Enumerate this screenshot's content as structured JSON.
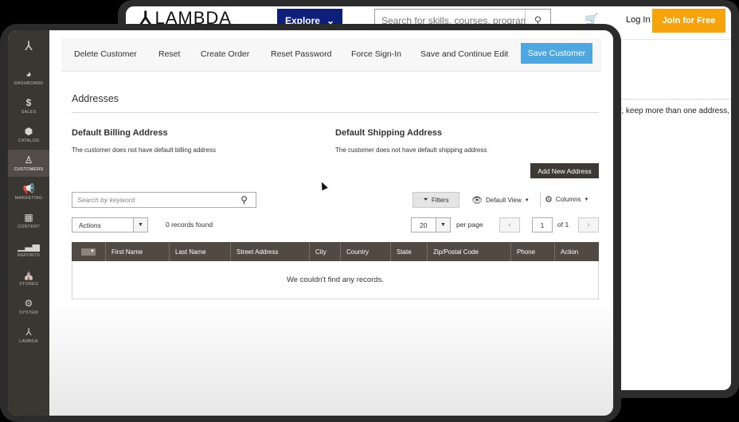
{
  "website": {
    "logo_text": "LAMBDA",
    "explore_label": "Explore",
    "search_placeholder": "Search for skills, courses, programmes",
    "login_label": "Log In",
    "join_label": "Join for Free",
    "side_text": "er, keep more than one address,"
  },
  "sidebar": {
    "items": [
      {
        "label": "DASHBOARD",
        "icon": "dashboard-icon"
      },
      {
        "label": "SALES",
        "icon": "dollar-icon"
      },
      {
        "label": "CATALOG",
        "icon": "cube-icon"
      },
      {
        "label": "CUSTOMERS",
        "icon": "person-icon",
        "active": true
      },
      {
        "label": "MARKETING",
        "icon": "megaphone-icon"
      },
      {
        "label": "CONTENT",
        "icon": "content-icon"
      },
      {
        "label": "REPORTS",
        "icon": "bar-chart-icon"
      },
      {
        "label": "STORES",
        "icon": "store-icon"
      },
      {
        "label": "SYSTEM",
        "icon": "gear-icon"
      },
      {
        "label": "LAMBDA",
        "icon": "lambda-icon"
      }
    ]
  },
  "toolbar": {
    "delete_customer": "Delete Customer",
    "reset": "Reset",
    "create_order": "Create Order",
    "reset_password": "Reset Password",
    "force_sign_in": "Force Sign-In",
    "save_continue": "Save and Continue Edit",
    "save_customer": "Save Customer"
  },
  "addresses": {
    "title": "Addresses",
    "billing_heading": "Default Billing Address",
    "billing_note": "The customer does not have default billing address",
    "shipping_heading": "Default Shipping Address",
    "shipping_note": "The customer does not have default shipping address",
    "add_new_label": "Add New Address"
  },
  "grid_controls": {
    "search_placeholder": "Search by keyword",
    "filters_label": "Filters",
    "view_label": "Default View",
    "columns_label": "Columns",
    "actions_label": "Actions",
    "records_found": "0 records found",
    "per_page_value": "20",
    "per_page_label": "per page",
    "page_value": "1",
    "page_of": "of 1"
  },
  "grid": {
    "columns": [
      "First Name",
      "Last Name",
      "Street Address",
      "City",
      "Country",
      "State",
      "Zip/Postal Code",
      "Phone",
      "Action"
    ],
    "empty_message": "We couldn't find any records."
  },
  "colors": {
    "sidebar_bg": "#3a3632",
    "save_button": "#4fa7e0",
    "grid_header": "#514943",
    "explore_button": "#0e1f7a",
    "join_button": "#f7a30c"
  }
}
